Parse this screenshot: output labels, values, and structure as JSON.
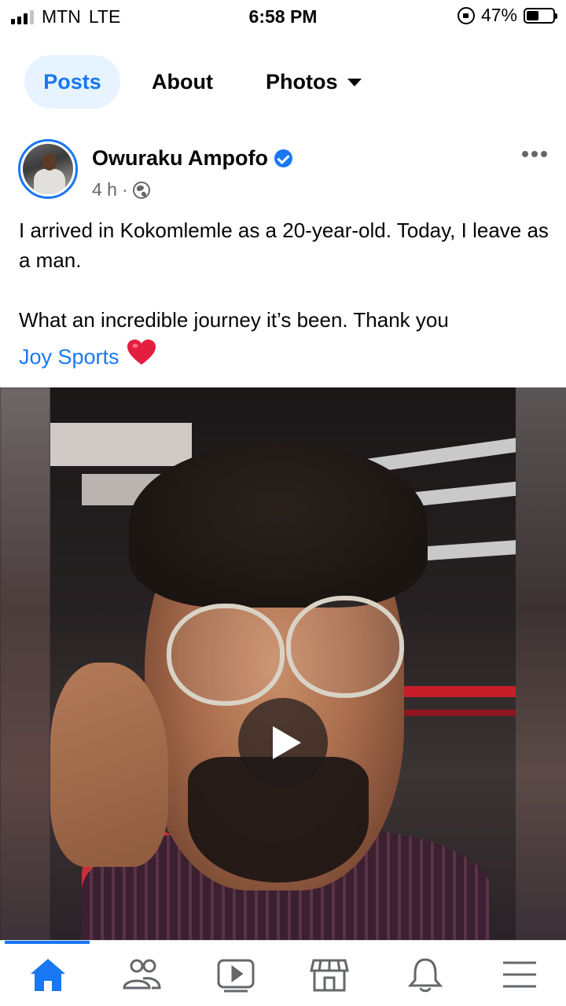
{
  "status_bar": {
    "carrier": "MTN",
    "network": "LTE",
    "time": "6:58 PM",
    "battery": "47%",
    "battery_level": 0.47
  },
  "tabs": [
    {
      "label": "Posts",
      "active": true
    },
    {
      "label": "About",
      "active": false
    },
    {
      "label": "Photos",
      "active": false
    }
  ],
  "post": {
    "author": "Owuraku Ampofo",
    "verified": true,
    "time": "4 h",
    "separator": "·",
    "audience_icon": "globe-icon",
    "text_para1": "I arrived in Kokomlemle as a 20-year-old. Today, I leave as a man.",
    "text_para2": "What an incredible journey it’s been. Thank you",
    "mention": "Joy Sports",
    "emoji": "❤️",
    "media": {
      "type": "video",
      "play_icon": "play-icon"
    }
  },
  "bottom_nav": {
    "items": [
      "home-icon",
      "friends-icon",
      "watch-icon",
      "marketplace-icon",
      "notifications-icon",
      "menu-icon"
    ],
    "active": "home-icon"
  },
  "colors": {
    "accent": "#1877f2",
    "active_tab_bg": "#e7f3ff",
    "secondary_text": "#65676b",
    "heart": "#e41e3f"
  }
}
